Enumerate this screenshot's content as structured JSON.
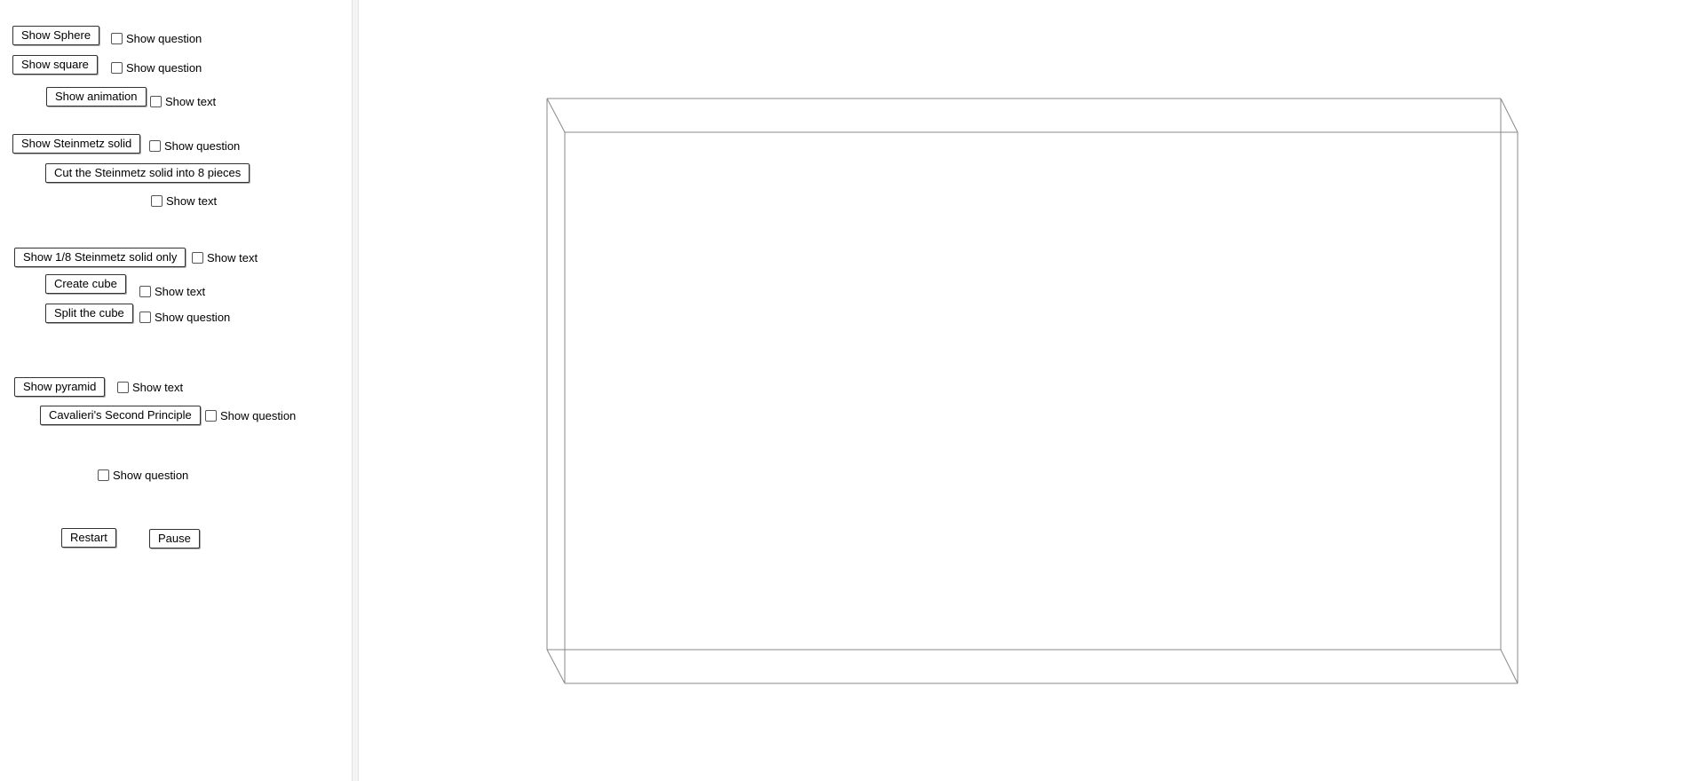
{
  "controls": {
    "show_sphere": "Show Sphere",
    "sphere_question": "Show question",
    "show_square": "Show square",
    "square_question": "Show question",
    "show_animation": "Show animation",
    "animation_text": "Show text",
    "show_steinmetz": "Show Steinmetz solid",
    "steinmetz_question": "Show question",
    "cut_steinmetz": "Cut the Steinmetz solid into 8 pieces",
    "cut_text": "Show text",
    "show_eighth": "Show 1/8 Steinmetz solid only",
    "eighth_text": "Show text",
    "create_cube": "Create cube",
    "cube_text": "Show text",
    "split_cube": "Split the cube",
    "split_question": "Show question",
    "show_pyramid": "Show pyramid",
    "pyramid_text": "Show text",
    "cavalieri": "Cavalieri's Second Principle",
    "cavalieri_question": "Show question",
    "final_question": "Show question",
    "restart": "Restart",
    "pause": "Pause"
  },
  "colors": {
    "box_edges": "#888888",
    "button_border": "#333333"
  }
}
